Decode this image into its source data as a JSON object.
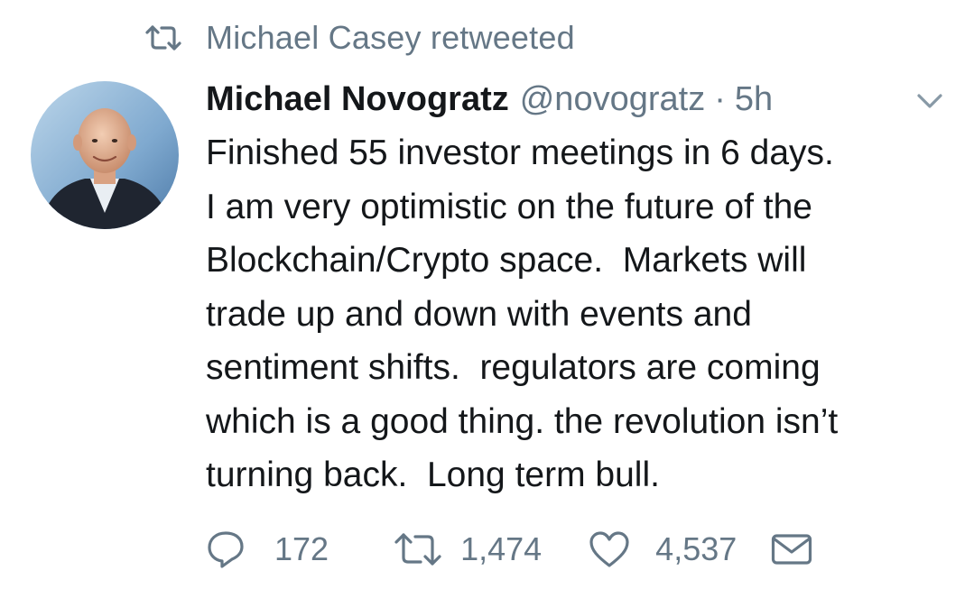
{
  "retweet_banner": {
    "icon": "retweet-icon",
    "text": "Michael Casey retweeted"
  },
  "tweet": {
    "avatar_icon": "avatar",
    "display_name": "Michael Novogratz",
    "handle": "@novogratz",
    "separator": "·",
    "time": "5h",
    "menu_icon": "chevron-down-icon",
    "text_lines": [
      "Finished 55 investor meetings in 6 days.",
      "I am very optimistic on the future of the",
      "Blockchain/Crypto space.  Markets will",
      "trade up and down with events and",
      "sentiment shifts.  regulators are coming",
      "which is a good thing. the revolution isn’t",
      "turning back.  Long term bull."
    ],
    "actions": {
      "reply": {
        "icon": "reply-icon",
        "count": "172"
      },
      "retweet": {
        "icon": "retweet-icon",
        "count": "1,474"
      },
      "like": {
        "icon": "heart-icon",
        "count": "4,537"
      },
      "dm": {
        "icon": "envelope-icon"
      }
    }
  },
  "colors": {
    "text_primary": "#14171a",
    "text_secondary": "#657786",
    "background": "#ffffff"
  }
}
